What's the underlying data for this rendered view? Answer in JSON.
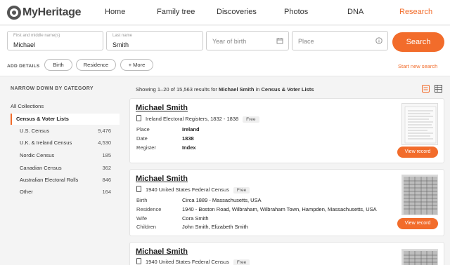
{
  "brand": {
    "logo_text": "MyHeritage",
    "accent": "#f26c2b"
  },
  "nav": {
    "items": [
      {
        "label": "Home"
      },
      {
        "label": "Family tree"
      },
      {
        "label": "Discoveries"
      },
      {
        "label": "Photos"
      },
      {
        "label": "DNA"
      },
      {
        "label": "Research"
      }
    ],
    "active": "Research"
  },
  "search": {
    "first_name_label": "First and middle name(s)",
    "first_name_value": "Michael",
    "last_name_label": "Last name",
    "last_name_value": "Smith",
    "year_placeholder": "Year of birth",
    "place_placeholder": "Place",
    "search_label": "Search",
    "add_details_label": "ADD DETAILS",
    "detail_pills": [
      "Birth",
      "Residence",
      "+ More"
    ],
    "start_new_label": "Start new search"
  },
  "sidebar": {
    "title": "NARROW DOWN BY CATEGORY",
    "all_collections": "All Collections",
    "selected": "Census & Voter Lists",
    "categories": [
      {
        "label": "U.S. Census",
        "count": "9,476"
      },
      {
        "label": "U.K. & Ireland Census",
        "count": "4,530"
      },
      {
        "label": "Nordic Census",
        "count": "185"
      },
      {
        "label": "Canadian Census",
        "count": "362"
      },
      {
        "label": "Australian Electoral Rolls",
        "count": "846"
      },
      {
        "label": "Other",
        "count": "164"
      }
    ]
  },
  "results": {
    "summary_prefix": "Showing 1–20 of 15,563 results for",
    "summary_query": "Michael Smith",
    "summary_in": "in",
    "summary_category": "Census & Voter Lists",
    "cards": [
      {
        "name": "Michael Smith",
        "collection": "Ireland Electoral Registers, 1832 - 1838",
        "badge": "Free",
        "rows": [
          {
            "label": "Place",
            "value": "Ireland"
          },
          {
            "label": "Date",
            "value": "1838"
          },
          {
            "label": "Register",
            "value": "Index"
          }
        ],
        "button": "View record"
      },
      {
        "name": "Michael Smith",
        "collection": "1940 United States Federal Census",
        "badge": "Free",
        "rows": [
          {
            "label": "Birth",
            "value": "Circa 1889 - Massachusetts, USA"
          },
          {
            "label": "Residence",
            "value": "1940 - Boston Road, Wilbraham, Wilbraham Town, Hampden, Massachusetts, USA"
          },
          {
            "label": "Wife",
            "value": "Cora Smith"
          },
          {
            "label": "Children",
            "value": "John Smith, Elizabeth Smith"
          }
        ],
        "button": "View record"
      },
      {
        "name": "Michael Smith",
        "collection": "1940 United States Federal Census",
        "badge": "Free"
      }
    ]
  }
}
